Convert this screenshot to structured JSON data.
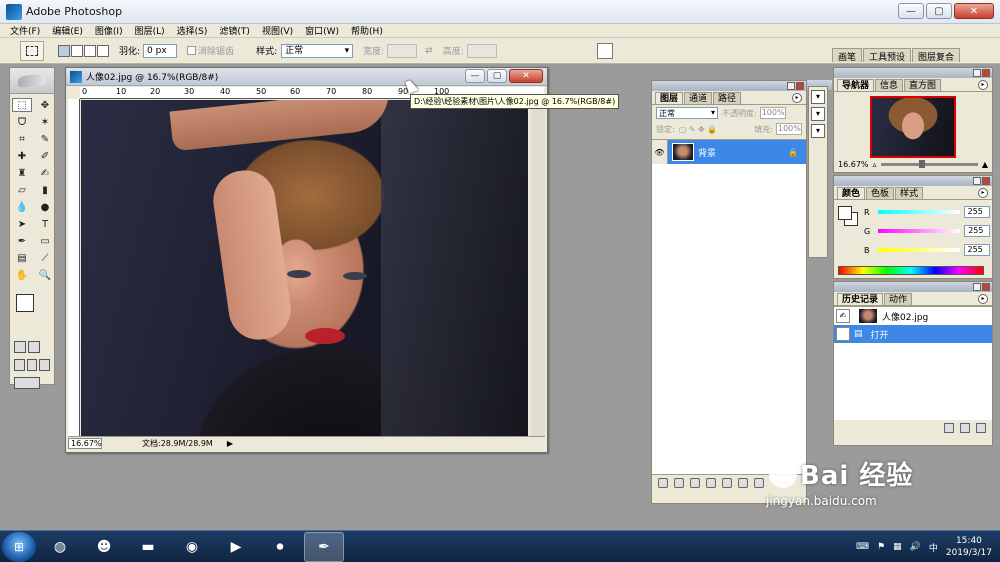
{
  "window": {
    "title": "Adobe Photoshop"
  },
  "menu": [
    "文件(F)",
    "编辑(E)",
    "图像(I)",
    "图层(L)",
    "选择(S)",
    "滤镜(T)",
    "视图(V)",
    "窗口(W)",
    "帮助(H)"
  ],
  "options": {
    "feather_label": "羽化:",
    "feather_value": "0 px",
    "antialias_label": "消除锯齿",
    "style_label": "样式:",
    "style_value": "正常",
    "width_label": "宽度:",
    "height_label": "高度:"
  },
  "palette_well": [
    "画笔",
    "工具预设",
    "图层复合"
  ],
  "document": {
    "title": "人像02.jpg @ 16.7%(RGB/8#)",
    "ruler_marks": [
      "0",
      "10",
      "20",
      "30",
      "40",
      "50",
      "60",
      "70",
      "80",
      "90",
      "100"
    ],
    "zoom": "16.67%",
    "doc_info": "文档:28.9M/28.9M",
    "tooltip": "D:\\经验\\经验素材\\图片\\人像02.jpg @ 16.7%(RGB/8#)"
  },
  "layers_panel": {
    "tabs": [
      "图层",
      "通道",
      "路径"
    ],
    "blend_mode": "正常",
    "opacity_label": "不透明度:",
    "opacity_value": "100%",
    "lock_label": "锁定:",
    "fill_label": "填充:",
    "fill_value": "100%",
    "layer_name": "背景"
  },
  "navigator": {
    "tabs": [
      "导航器",
      "信息",
      "直方图"
    ],
    "zoom": "16.67%"
  },
  "color_panel": {
    "tabs": [
      "颜色",
      "色板",
      "样式"
    ],
    "channels": [
      {
        "label": "R",
        "value": "255",
        "color": "#44d6d6"
      },
      {
        "label": "G",
        "value": "255",
        "color": "#e04be0"
      },
      {
        "label": "B",
        "value": "255",
        "color": "#e8e84a"
      }
    ]
  },
  "history": {
    "tabs": [
      "历史记录",
      "动作"
    ],
    "snapshot": "人像02.jpg",
    "items": [
      "打开"
    ]
  },
  "taskbar": {
    "time": "15:40",
    "date": "2019/3/17"
  },
  "watermark": {
    "brand": "Bai  经验",
    "url": "jingyan.baidu.com"
  }
}
